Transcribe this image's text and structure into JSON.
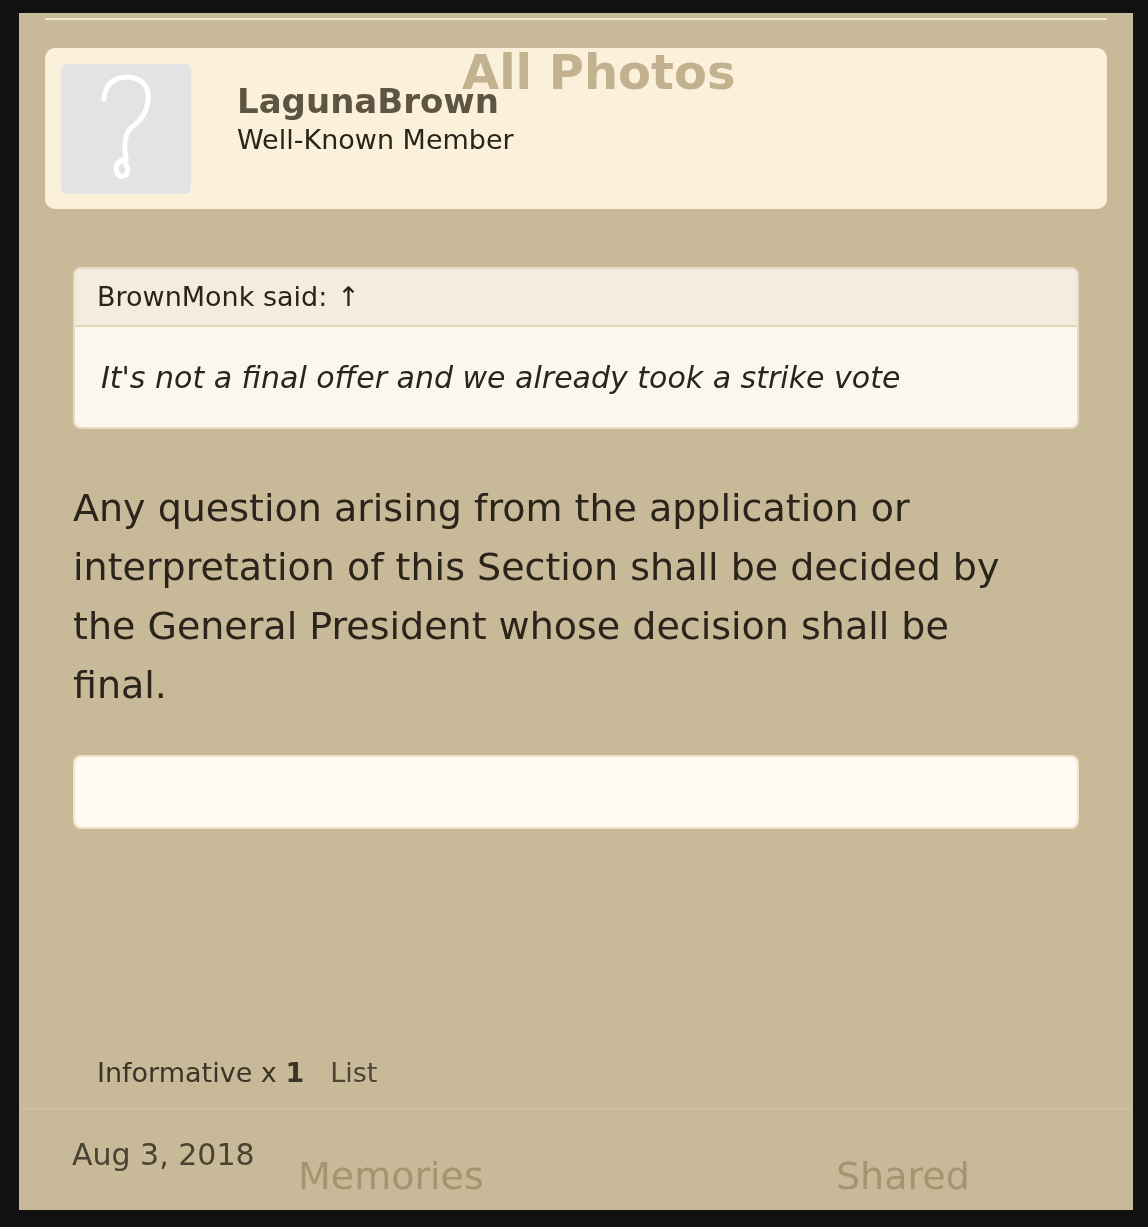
{
  "background_app": {
    "title": "All Photos",
    "tabs": [
      "Memories",
      "Shared"
    ]
  },
  "post": {
    "author": "LagunaBrown",
    "role": "Well-Known Member",
    "quote": {
      "attribution": "BrownMonk said:",
      "arrow": "↑",
      "text": "It's not a final offer and we already took a strike vote"
    },
    "body": "Any question arising from the application or interpretation of this Section shall be decided by the General President whose decision shall be final.",
    "reactions": {
      "label": "Informative x ",
      "count": "1",
      "link": "List"
    },
    "date": "Aug 3, 2018"
  }
}
